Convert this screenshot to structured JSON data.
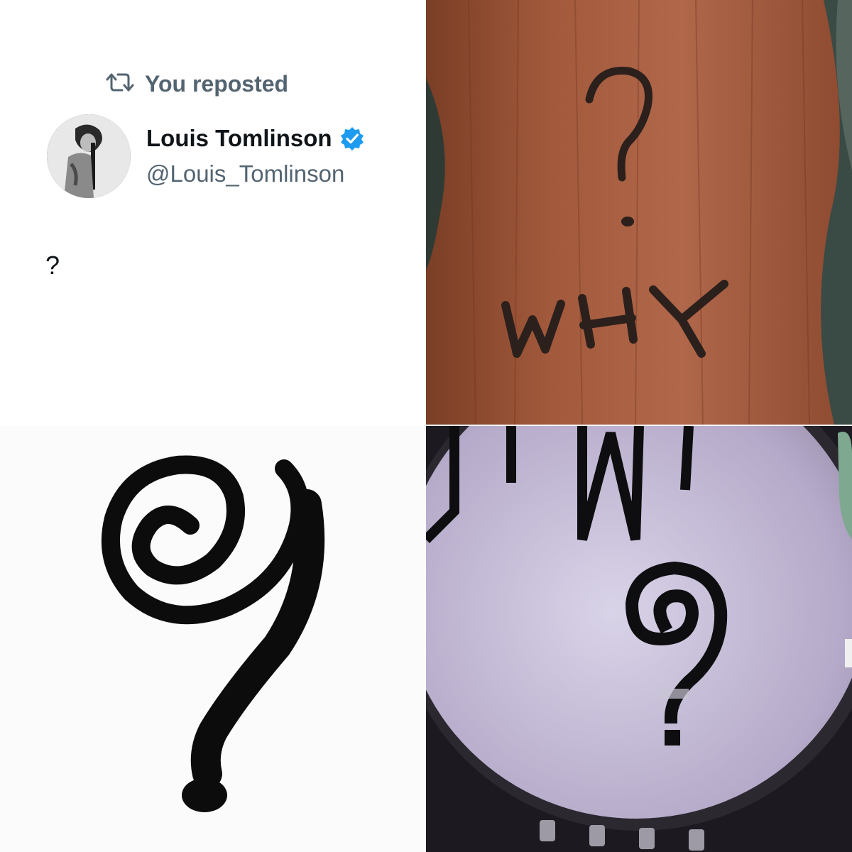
{
  "tweet": {
    "repost_label": "You reposted",
    "display_name": "Louis Tomlinson",
    "handle": "@Louis_Tomlinson",
    "text": "?",
    "icons": {
      "repost": "repost-icon",
      "verified": "verified-badge-icon"
    },
    "colors": {
      "secondary_text": "#536471",
      "primary_text": "#0f1419",
      "verified_blue": "#1d9bf0"
    }
  },
  "photo_top_right": {
    "carved_text": "WHY"
  }
}
